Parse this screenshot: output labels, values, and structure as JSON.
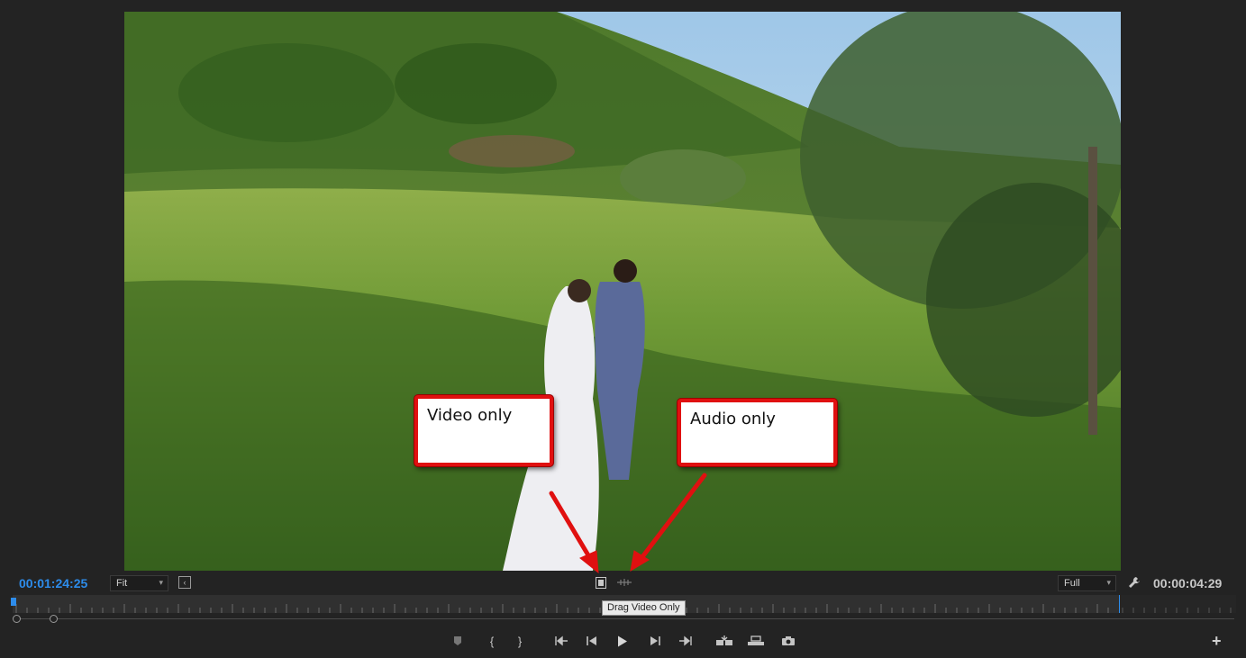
{
  "monitor": {
    "current_timecode": "00:01:24:25",
    "duration_timecode": "00:00:04:29",
    "zoom_select": "Fit",
    "resolution_select": "Full",
    "tooltip": "Drag Video Only"
  },
  "annotations": {
    "video_only_label": "Video only",
    "audio_only_label": "Audio only",
    "accent_color": "#e01010"
  },
  "icons": {
    "drag_video_only": "filmstrip-icon",
    "drag_audio_only": "waveform-icon",
    "settings": "wrench-icon",
    "export_frame": "camera-icon"
  },
  "colors": {
    "timecode_current": "#2d8ceb",
    "panel_background": "#232323"
  }
}
